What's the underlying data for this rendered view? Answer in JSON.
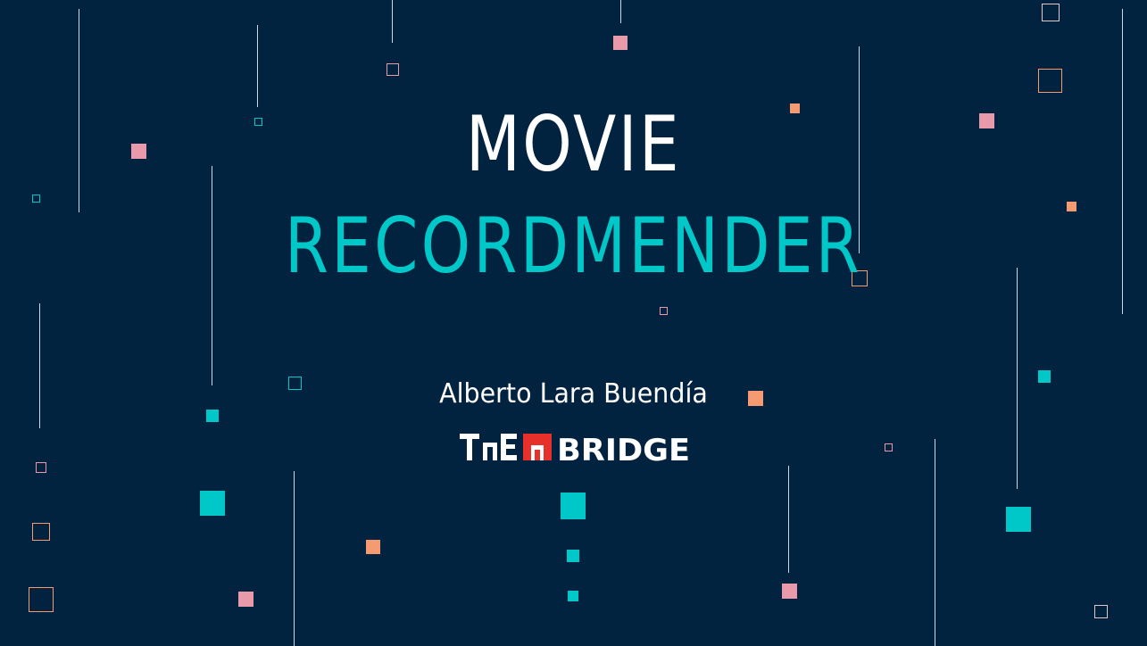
{
  "slide": {
    "title_line1": "MOVIE",
    "title_line2": "RECORDMENDER",
    "author": "Alberto Lara Buendía",
    "logo_text": "THE BRIDGE"
  },
  "colors": {
    "background": "#022340",
    "title_primary": "#ffffff",
    "title_accent": "#00c8c8",
    "author_text": "#ffffff",
    "square_pink": "#e89aaa",
    "square_orange": "#f69a72",
    "square_teal": "#00c8c8",
    "logo_red": "#e8302b",
    "line": "#e9eaf2"
  }
}
